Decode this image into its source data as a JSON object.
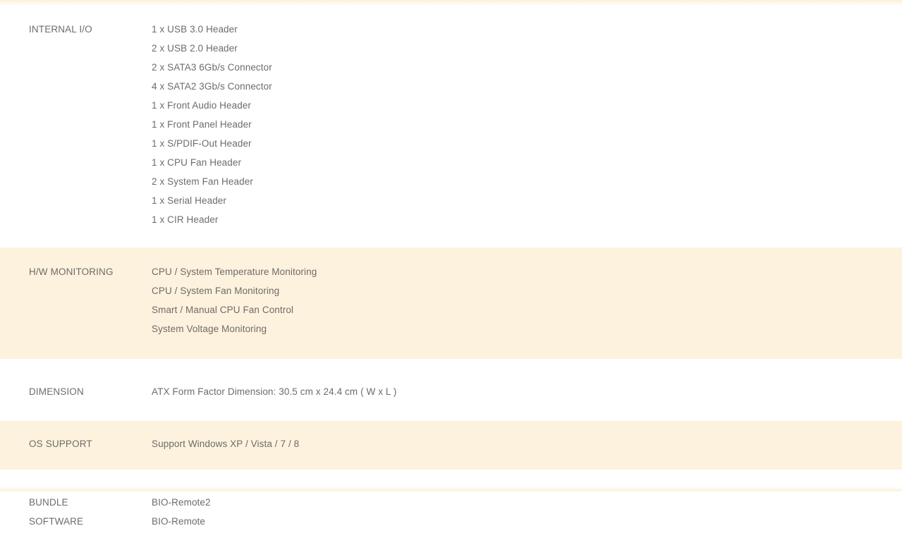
{
  "page": {
    "title": "Motherboard Specification Table",
    "text_color": "#6e6c68",
    "shaded_row_color": "#fdf2de",
    "background_color": "#ffffff"
  },
  "rows": [
    {
      "key": "internal_io",
      "label": "INTERNAL I/O",
      "shaded": false,
      "values": [
        "1 x USB 3.0 Header",
        "2 x USB 2.0 Header",
        "2 x SATA3 6Gb/s Connector",
        "4 x SATA2 3Gb/s Connector",
        "1 x Front Audio Header",
        "1 x Front Panel Header",
        "1 x S/PDIF-Out Header",
        "1 x CPU Fan Header",
        "2 x System Fan Header",
        "1 x Serial Header",
        "1 x CIR Header"
      ]
    },
    {
      "key": "hw_monitoring",
      "label": "H/W MONITORING",
      "shaded": true,
      "values": [
        "CPU / System Temperature Monitoring",
        "CPU / System Fan Monitoring",
        "Smart / Manual CPU Fan Control",
        "System Voltage Monitoring"
      ]
    },
    {
      "key": "dimension",
      "label": "DIMENSION",
      "shaded": false,
      "values": [
        "ATX Form Factor Dimension: 30.5 cm x 24.4 cm ( W x L )"
      ]
    },
    {
      "key": "os_support",
      "label": "OS SUPPORT",
      "shaded": true,
      "values": [
        "Support Windows XP / Vista / 7 / 8"
      ]
    },
    {
      "key": "bundle_software",
      "label": "BUNDLE\nSOFTWARE",
      "shaded": false,
      "values": [
        "BIO-Remote2",
        "BIO-Remote"
      ]
    }
  ]
}
